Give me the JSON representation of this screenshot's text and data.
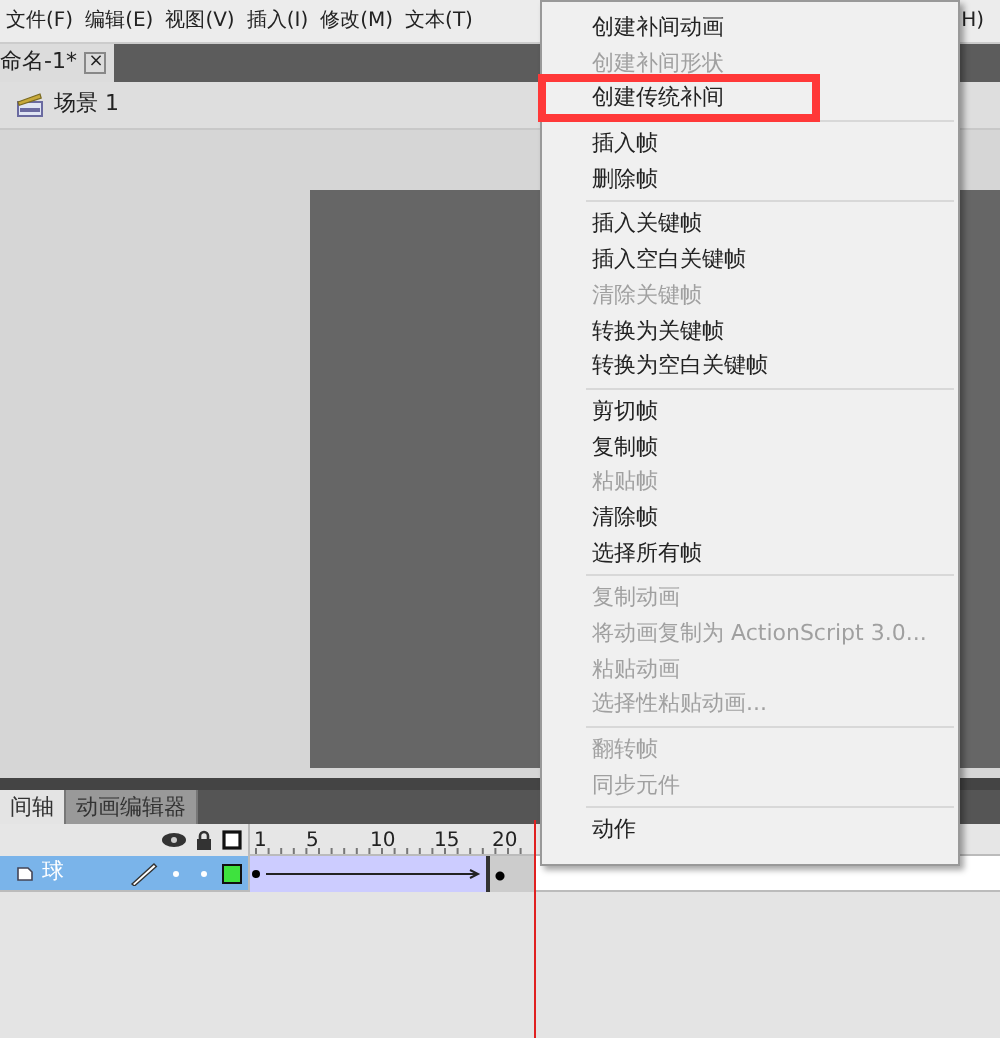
{
  "menu_bar": [
    {
      "label": "文件(F)"
    },
    {
      "label": "编辑(E)"
    },
    {
      "label": "视图(V)"
    },
    {
      "label": "插入(I)"
    },
    {
      "label": "修改(M)"
    },
    {
      "label": "文本(T)"
    },
    {
      "label": "H)"
    }
  ],
  "document_tab": {
    "title": "命名-1*",
    "close": "×"
  },
  "scene": {
    "label": "场景 1"
  },
  "timeline": {
    "tabs": [
      {
        "label": "间轴",
        "selected": true
      },
      {
        "label": "动画编辑器",
        "selected": false
      }
    ],
    "ruler": [
      "1",
      "5",
      "10",
      "15",
      "20"
    ],
    "layers": [
      {
        "name": "球",
        "selected": true
      }
    ]
  },
  "context_menu": [
    [
      {
        "label": "创建补间动画",
        "disabled": false,
        "boxed": false
      },
      {
        "label": "创建补间形状",
        "disabled": true,
        "boxed": false
      },
      {
        "label": "创建传统补间",
        "disabled": false,
        "boxed": true
      }
    ],
    [
      {
        "label": "插入帧",
        "disabled": false,
        "boxed": false
      },
      {
        "label": "删除帧",
        "disabled": false,
        "boxed": false
      }
    ],
    [
      {
        "label": "插入关键帧",
        "disabled": false,
        "boxed": false
      },
      {
        "label": "插入空白关键帧",
        "disabled": false,
        "boxed": false
      },
      {
        "label": "清除关键帧",
        "disabled": true,
        "boxed": false
      },
      {
        "label": "转换为关键帧",
        "disabled": false,
        "boxed": false
      },
      {
        "label": "转换为空白关键帧",
        "disabled": false,
        "boxed": false
      }
    ],
    [
      {
        "label": "剪切帧",
        "disabled": false,
        "boxed": false
      },
      {
        "label": "复制帧",
        "disabled": false,
        "boxed": false
      },
      {
        "label": "粘贴帧",
        "disabled": true,
        "boxed": false
      },
      {
        "label": "清除帧",
        "disabled": false,
        "boxed": false
      },
      {
        "label": "选择所有帧",
        "disabled": false,
        "boxed": false
      }
    ],
    [
      {
        "label": "复制动画",
        "disabled": true,
        "boxed": false
      },
      {
        "label": "将动画复制为 ActionScript 3.0...",
        "disabled": true,
        "boxed": false
      },
      {
        "label": "粘贴动画",
        "disabled": true,
        "boxed": false
      },
      {
        "label": "选择性粘贴动画...",
        "disabled": true,
        "boxed": false
      }
    ],
    [
      {
        "label": "翻转帧",
        "disabled": true,
        "boxed": false
      },
      {
        "label": "同步元件",
        "disabled": true,
        "boxed": false
      }
    ],
    [
      {
        "label": "动作",
        "disabled": false,
        "boxed": false
      }
    ]
  ]
}
